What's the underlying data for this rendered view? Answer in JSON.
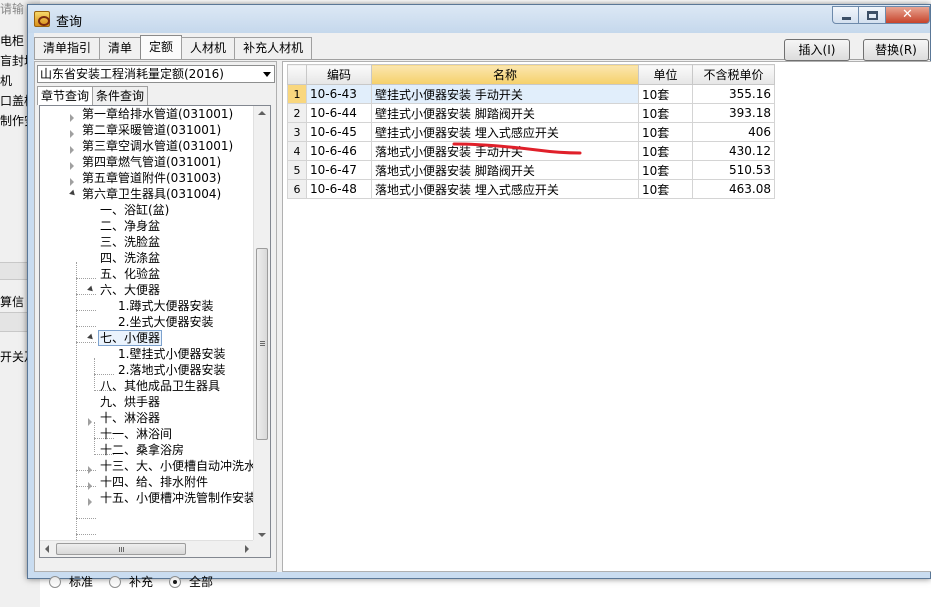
{
  "background_window": {
    "fragments": [
      "请输",
      "电柜",
      "盲封堵",
      "机",
      "口盖板",
      "制作安",
      "算信",
      "开关及"
    ]
  },
  "dialog": {
    "title": "查询",
    "tabs": [
      "清单指引",
      "清单",
      "定额",
      "人材机",
      "补充人材机"
    ],
    "active_tab": "定额",
    "buttons": {
      "insert": "插入(I)",
      "replace": "替换(R)"
    }
  },
  "left_panel": {
    "quota_selector": "山东省安装工程消耗量定额(2016)",
    "subtabs": [
      "章节查询",
      "条件查询"
    ],
    "tree": [
      {
        "label": "第一章给排水管道(031001)",
        "state": "collapsed"
      },
      {
        "label": "第二章采暖管道(031001)",
        "state": "collapsed"
      },
      {
        "label": "第三章空调水管道(031001)",
        "state": "collapsed"
      },
      {
        "label": "第四章燃气管道(031001)",
        "state": "collapsed"
      },
      {
        "label": "第五章管道附件(031003)",
        "state": "collapsed"
      },
      {
        "label": "第六章卫生器具(031004)",
        "state": "expanded"
      },
      {
        "label": "一、浴缸(盆)",
        "state": "leaf"
      },
      {
        "label": "二、净身盆",
        "state": "leaf"
      },
      {
        "label": "三、洗脸盆",
        "state": "leaf"
      },
      {
        "label": "四、洗涤盆",
        "state": "leaf"
      },
      {
        "label": "五、化验盆",
        "state": "leaf"
      },
      {
        "label": "六、大便器",
        "state": "expanded"
      },
      {
        "label": "1.蹲式大便器安装",
        "state": "leaf"
      },
      {
        "label": "2.坐式大便器安装",
        "state": "leaf"
      },
      {
        "label": "七、小便器",
        "state": "expanded",
        "selected": true
      },
      {
        "label": "1.壁挂式小便器安装",
        "state": "leaf"
      },
      {
        "label": "2.落地式小便器安装",
        "state": "leaf"
      },
      {
        "label": "八、其他成品卫生器具",
        "state": "leaf"
      },
      {
        "label": "九、烘手器",
        "state": "leaf"
      },
      {
        "label": "十、淋浴器",
        "state": "collapsed"
      },
      {
        "label": "十一、淋浴间",
        "state": "leaf"
      },
      {
        "label": "十二、桑拿浴房",
        "state": "leaf"
      },
      {
        "label": "十三、大、小便槽自动冲洗水",
        "state": "collapsed"
      },
      {
        "label": "十四、给、排水附件",
        "state": "collapsed"
      },
      {
        "label": "十五、小便槽冲洗管制作安装",
        "state": "collapsed"
      }
    ],
    "filter_options": [
      "标准",
      "补充",
      "全部"
    ],
    "filter_selected": "全部"
  },
  "grid": {
    "columns": [
      "编码",
      "名称",
      "单位",
      "不含税单价"
    ],
    "rows": [
      {
        "num": "1",
        "code": "10-6-43",
        "name": "壁挂式小便器安装 手动开关",
        "unit": "10套",
        "price": "355.16"
      },
      {
        "num": "2",
        "code": "10-6-44",
        "name": "壁挂式小便器安装 脚踏阀开关",
        "unit": "10套",
        "price": "393.18"
      },
      {
        "num": "3",
        "code": "10-6-45",
        "name": "壁挂式小便器安装 埋入式感应开关",
        "unit": "10套",
        "price": "406"
      },
      {
        "num": "4",
        "code": "10-6-46",
        "name": "落地式小便器安装 手动开关",
        "unit": "10套",
        "price": "430.12"
      },
      {
        "num": "5",
        "code": "10-6-47",
        "name": "落地式小便器安装 脚踏阀开关",
        "unit": "10套",
        "price": "510.53"
      },
      {
        "num": "6",
        "code": "10-6-48",
        "name": "落地式小便器安装 埋入式感应开关",
        "unit": "10套",
        "price": "463.08"
      }
    ]
  },
  "annotation": {
    "color": "#e0202a",
    "icon": "red-underline-annotation"
  },
  "colors": {
    "title_bar": "#c9dcf0",
    "header_highlight": "#f5d06a",
    "selected_row": "#e1eefb"
  }
}
